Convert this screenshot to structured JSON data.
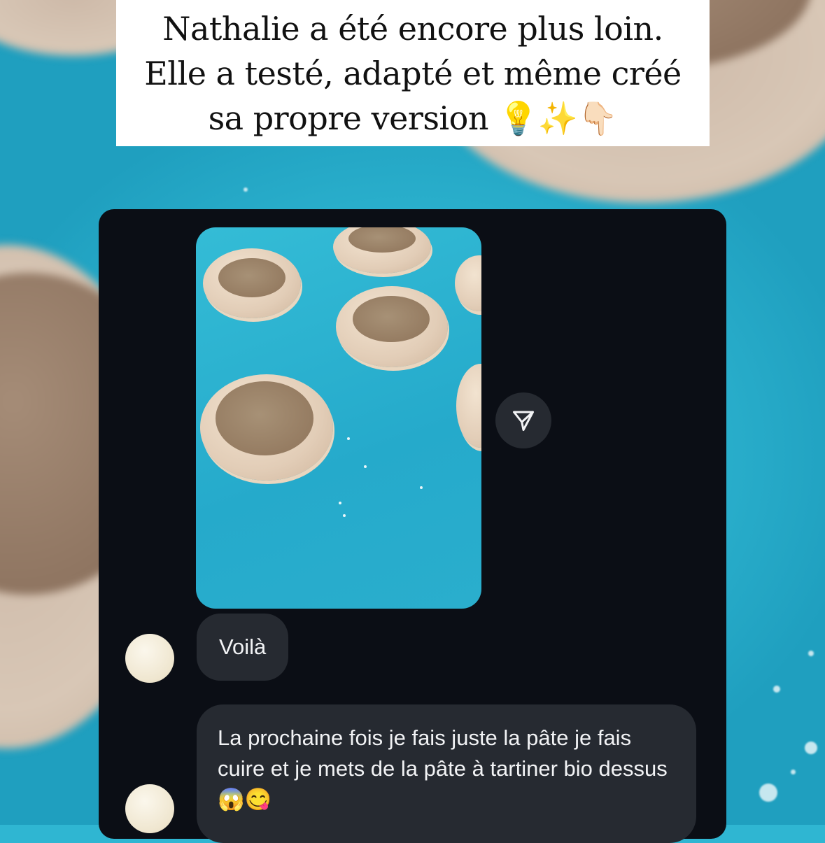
{
  "caption": {
    "line1": "Nathalie a été encore plus loin.",
    "line2": "Elle a testé, adapté et même créé",
    "line3": "sa propre version 💡✨👇🏻"
  },
  "chat": {
    "messages": [
      {
        "type": "image",
        "alt": ""
      },
      {
        "type": "text",
        "text": "Voilà"
      },
      {
        "type": "text",
        "text": "La prochaine fois je fais juste la pâte je fais cuire et je mets de la pâte à tartiner bio dessus 😱😋"
      }
    ],
    "share_icon": "paper-plane-icon"
  },
  "colors": {
    "panel": "#0b0e15",
    "bubble": "#262a31",
    "background": "#2fb6d2"
  }
}
